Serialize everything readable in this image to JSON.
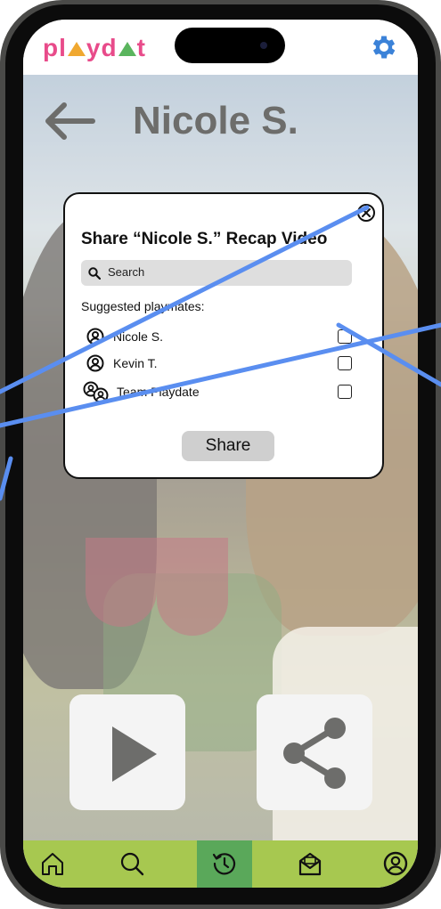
{
  "app": {
    "logo_text": "playdate",
    "brand_colors": {
      "pink": "#e84b8a",
      "orange": "#f0a830",
      "green": "#5ab55e",
      "blue": "#3aa0d8",
      "nav": "#a7c850",
      "nav_active": "#5aa85a"
    },
    "settings_icon": "gear-icon"
  },
  "header": {
    "back_icon": "arrow-left-icon",
    "title": "Nicole S."
  },
  "modal": {
    "title": "Share “Nicole S.” Recap Video",
    "close_icon": "close-circle-icon",
    "search": {
      "placeholder": "Search",
      "icon": "search-icon"
    },
    "suggested_label": "Suggested playmates:",
    "playmates": [
      {
        "name": "Nicole S.",
        "icon": "user-circle-icon",
        "checked": false
      },
      {
        "name": "Kevin T.",
        "icon": "user-circle-icon",
        "checked": false
      },
      {
        "name": "Team Playdate",
        "icon": "group-icon",
        "checked": false
      }
    ],
    "share_label": "Share"
  },
  "actions": {
    "play_icon": "play-icon",
    "share_icon": "share-icon"
  },
  "nav": {
    "items": [
      {
        "icon": "home-icon",
        "active": false
      },
      {
        "icon": "search-icon",
        "active": false
      },
      {
        "icon": "history-icon",
        "active": true
      },
      {
        "icon": "inbox-icon",
        "active": false
      },
      {
        "icon": "profile-icon",
        "active": false
      }
    ]
  }
}
